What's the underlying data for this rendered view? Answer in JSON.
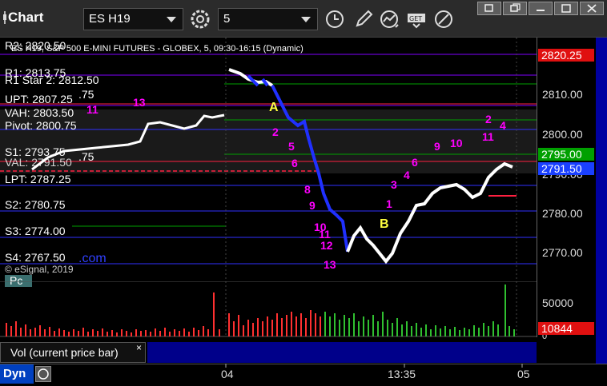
{
  "toolbar": {
    "app_title": "Chart",
    "symbol": "ES H19",
    "interval": "5"
  },
  "chart": {
    "header_r2": "R2: 2820.50",
    "header_desc": "ES H19, S&P 500 E-MINI FUTURES - GLOBEX, 5, 09:30-16:15 (Dynamic)",
    "r1": "R1: 2813.75",
    "r1_star": "R1 Star 2: 2812.50",
    "upt": "UPT: 2807.25",
    "upt_tail": ".75",
    "vah": "VAH: 2803.50",
    "pivot": "Pivot: 2800.75",
    "s1": "S1: 2793.75",
    "val_overlap": "VAL: 2791.50",
    "val_tail": ".75",
    "lpt": "LPT: 2787.25",
    "s2": "S2: 2780.75",
    "s3": "S3: 2774.00",
    "s4": "S4: 2767.50",
    "pc": "Pc",
    "com": ".com",
    "watermark": "© eSignal, 2019",
    "marker_a": "A",
    "marker_b": "B",
    "counts": {
      "c11": "11",
      "c13a": "13",
      "c2": "2",
      "c5": "5",
      "c6": "6",
      "c8": "8",
      "c9": "9",
      "c10": "10",
      "c11b": "11",
      "c12": "12",
      "c13b": "13",
      "c1": "1",
      "c3": "3",
      "c4": "4",
      "c6b": "6",
      "c9b": "9",
      "c10b": "10",
      "c2b": "2",
      "c4b": "4",
      "c11c": "11"
    }
  },
  "price_axis": {
    "ticks": [
      "2810.00",
      "2800.00",
      "2790.00",
      "2780.00",
      "2770.00"
    ],
    "tag_r2": "2820.25",
    "tag_green": "2795.00",
    "tag_blue": "2791.50",
    "vol_tick_high": "50000",
    "vol_tick_low": "0",
    "vol_tag": "10844"
  },
  "volume": {
    "label": "Vol (current price bar)",
    "close": "×"
  },
  "time_axis": {
    "dyn": "Dyn",
    "t1": "04",
    "t2": "13:35",
    "t3": "05"
  },
  "colors": {
    "r_line": "#8000ff",
    "green_line": "#00a000",
    "red_line": "#ff2040",
    "blue_line": "#3030ff",
    "magenta": "#ff00ff",
    "yellow": "#ffff40",
    "tag_red": "#e01010",
    "tag_green": "#00a000",
    "tag_blue": "#1a40ff"
  }
}
